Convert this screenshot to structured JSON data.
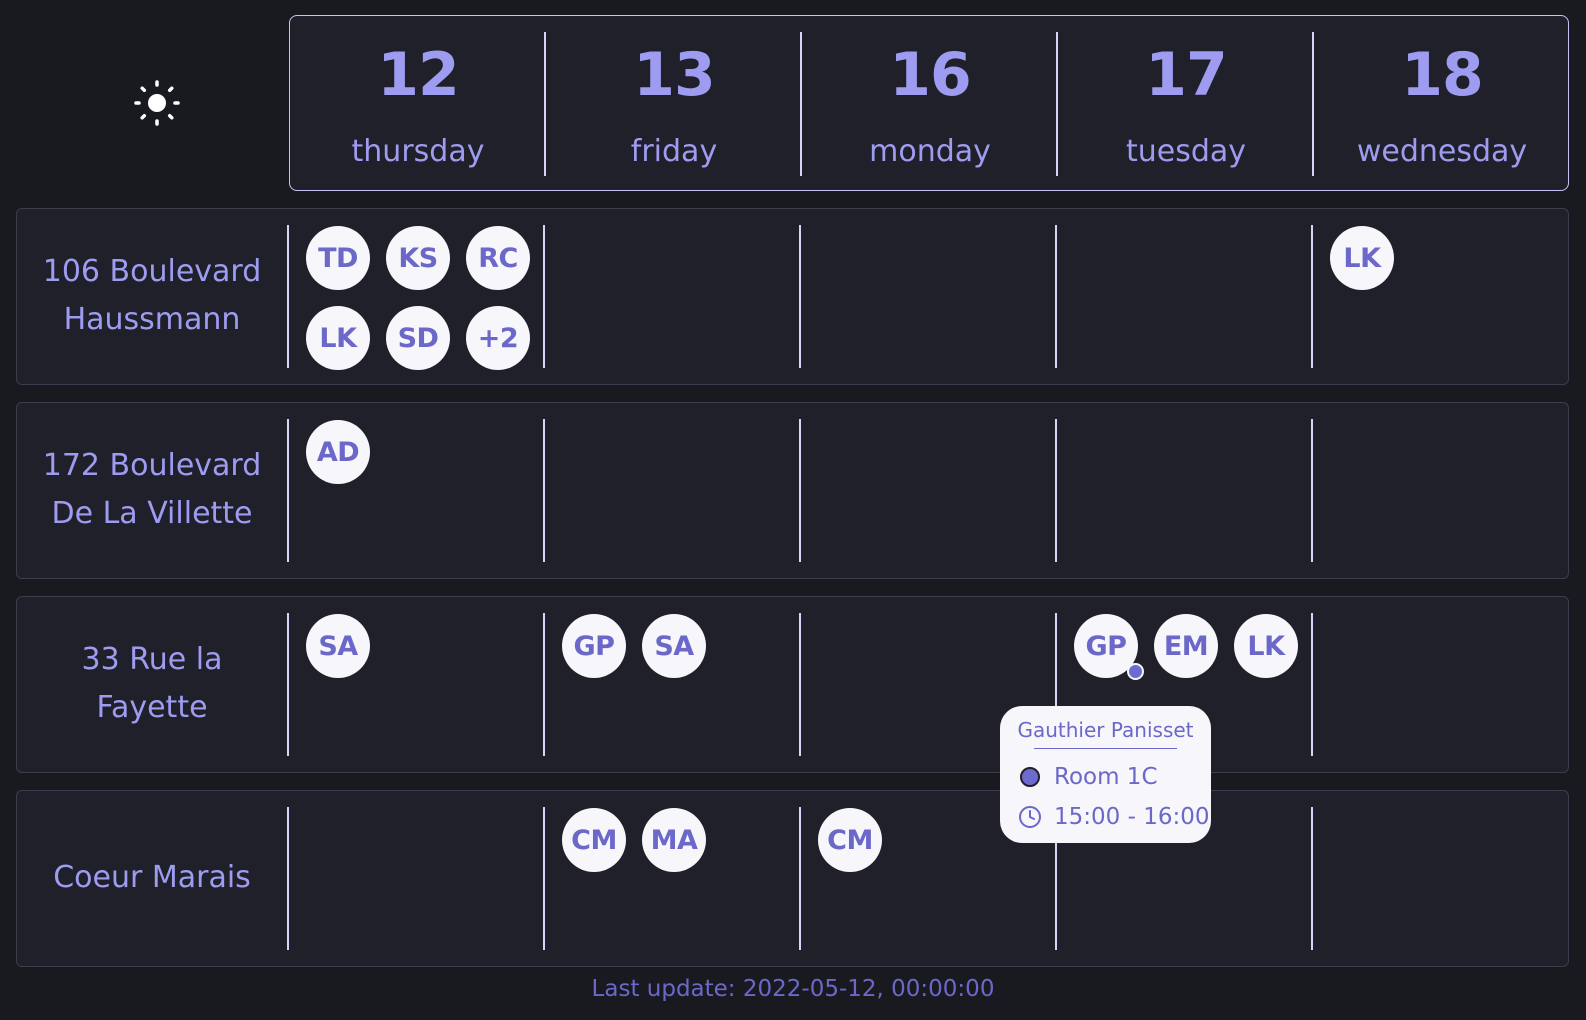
{
  "theme_toggle": {
    "icon": "sun-icon"
  },
  "days": [
    {
      "number": "12",
      "name": "thursday"
    },
    {
      "number": "13",
      "name": "friday"
    },
    {
      "number": "16",
      "name": "monday"
    },
    {
      "number": "17",
      "name": "tuesday"
    },
    {
      "number": "18",
      "name": "wednesday"
    }
  ],
  "sites": [
    {
      "name": "106 Boulevard Haussmann"
    },
    {
      "name": "172 Boulevard De La Villette"
    },
    {
      "name": "33 Rue la Fayette"
    },
    {
      "name": "Coeur Marais"
    }
  ],
  "bookings": {
    "site0": {
      "day0": [
        "TD",
        "KS",
        "RC",
        "LK",
        "SD",
        "+2"
      ],
      "day4": [
        "LK"
      ]
    },
    "site1": {
      "day0": [
        "AD"
      ]
    },
    "site2": {
      "day0": [
        "SA"
      ],
      "day1": [
        "GP",
        "SA"
      ],
      "day3": [
        "GP",
        "EM",
        "LK"
      ]
    },
    "site3": {
      "day1": [
        "CM",
        "MA"
      ],
      "day2": [
        "CM"
      ]
    }
  },
  "tooltip": {
    "name": "Gauthier Panisset",
    "room": "Room 1C",
    "time": "15:00 - 16:00"
  },
  "footer": {
    "last_update": "Last update: 2022-05-12, 00:00:00"
  },
  "colors": {
    "background": "#191a20",
    "panel": "#1f2029",
    "accent": "#9e9cf0",
    "avatar_text": "#6b68c9",
    "avatar_bg": "#f6f6fb"
  }
}
